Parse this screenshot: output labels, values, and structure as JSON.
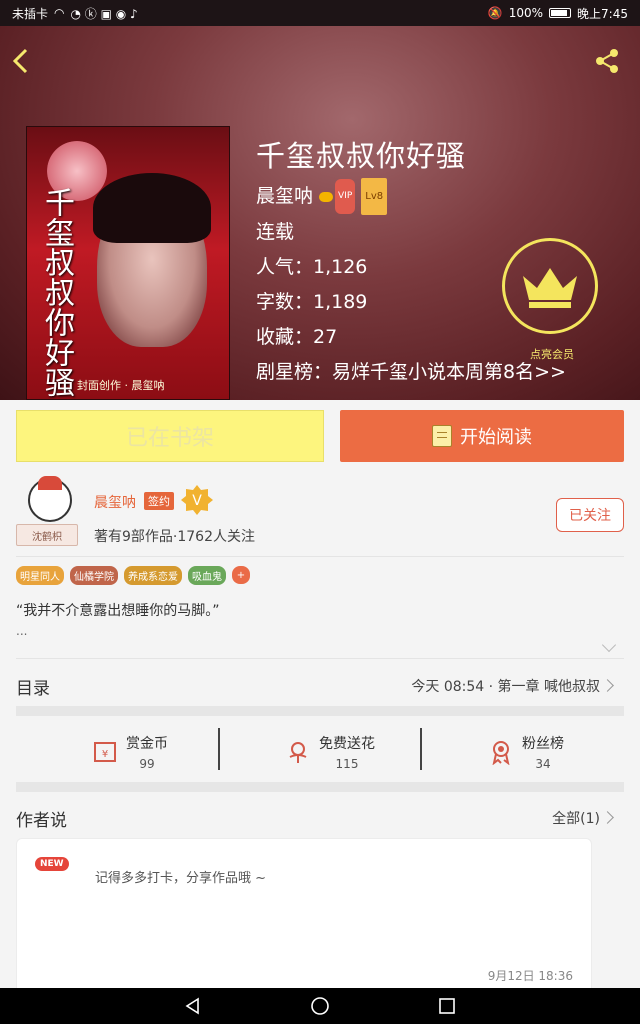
{
  "status_bar": {
    "carrier": "未插卡",
    "battery": "100%",
    "time": "晚上7:45"
  },
  "book": {
    "title": "千玺叔叔你好骚",
    "author": "晨玺呐",
    "vip": "VIP",
    "level": "Lv8",
    "status": "连载",
    "popularity": "人气：1,126",
    "word_count": "字数：1,189",
    "favorites": "收藏：27",
    "ranking": "剧星榜：易烊千玺小说本周第8名>>",
    "member_label": "点亮会员",
    "cover": {
      "title_vertical": "千玺叔叔你好骚",
      "bottom_text": "封面创作 · 晨玺呐"
    }
  },
  "actions": {
    "shelf": "已在书架",
    "read": "开始阅读"
  },
  "author_card": {
    "name": "晨玺呐",
    "sign": "签约",
    "avatar_tag": "沈鹤枳",
    "stats": "著有9部作品·1762人关注",
    "follow": "已关注"
  },
  "tags": [
    {
      "label": "明星同人",
      "color": "#e8a33b"
    },
    {
      "label": "仙橘学院",
      "color": "#c0654a"
    },
    {
      "label": "养成系恋爱",
      "color": "#d59a2f"
    },
    {
      "label": "吸血鬼",
      "color": "#6aa85a"
    }
  ],
  "tag_more": "+",
  "synopsis": {
    "quote": "“我并不介意露出想睡你的马脚。”",
    "ellipsis": "..."
  },
  "toc": {
    "label": "目录",
    "latest": "今天 08:54 · 第一章   喊他叔叔"
  },
  "stats": [
    {
      "label": "赏金币",
      "value": "99"
    },
    {
      "label": "免费送花",
      "value": "115"
    },
    {
      "label": "粉丝榜",
      "value": "34"
    }
  ],
  "author_says": {
    "label": "作者说",
    "all": "全部(1)",
    "new_badge": "NEW",
    "text": "记得多多打卡，分享作品哦 ~",
    "time": "9月12日   18:36"
  },
  "colors": {
    "accent": "#ec6c43",
    "shelf": "#fdf57e",
    "member": "#f4e55d"
  }
}
